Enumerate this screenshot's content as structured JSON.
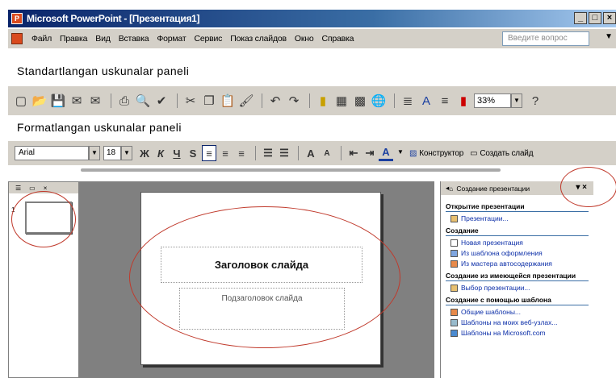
{
  "window": {
    "title": "Microsoft PowerPoint - [Презентация1]",
    "controls": [
      "_",
      "□",
      "×"
    ]
  },
  "menubar": {
    "items": [
      "Файл",
      "Правка",
      "Вид",
      "Вставка",
      "Формат",
      "Сервис",
      "Показ слайдов",
      "Окно",
      "Справка"
    ],
    "help_placeholder": "Введите вопрос"
  },
  "labels": {
    "standard": "Standartlangan uskunalar paneli",
    "formatting": "Formatlangan uskunalar paneli"
  },
  "standard_toolbar": {
    "zoom": "33%"
  },
  "formatting_toolbar": {
    "font": "Arial",
    "size": "18",
    "design_button": "Конструктор",
    "new_slide_button": "Создать слайд"
  },
  "left_panel": {
    "slide_number": "1"
  },
  "slide": {
    "title_placeholder": "Заголовок слайда",
    "subtitle_placeholder": "Подзаголовок слайда"
  },
  "task_pane": {
    "title": "Создание презентации",
    "sections": [
      {
        "heading": "Открытие презентации",
        "links": [
          "Презентации..."
        ]
      },
      {
        "heading": "Создание",
        "links": [
          "Новая презентация",
          "Из шаблона оформления",
          "Из мастера автосодержания"
        ]
      },
      {
        "heading": "Создание из имеющейся презентации",
        "links": [
          "Выбор презентации..."
        ]
      },
      {
        "heading": "Создание с помощью шаблона",
        "links": [
          "Общие шаблоны...",
          "Шаблоны на моих веб-узлах...",
          "Шаблоны на Microsoft.com"
        ]
      }
    ]
  },
  "colors": {
    "titlebar_start": "#0a246a",
    "toolbar_bg": "#d4d0c8",
    "link": "#0b2ea8",
    "annotation": "#c0392b"
  }
}
